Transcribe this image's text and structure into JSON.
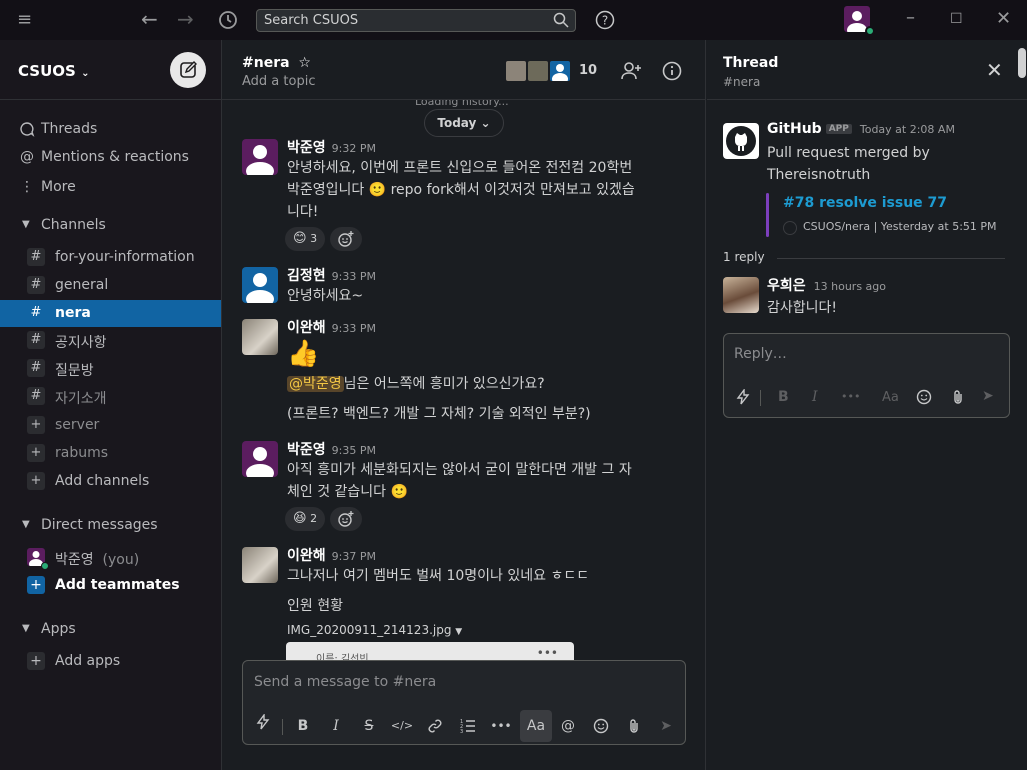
{
  "topbar": {
    "search_placeholder": "Search CSUOS"
  },
  "sidebar": {
    "workspace_name": "CSUOS",
    "nav": [
      {
        "label": "Threads",
        "icon": "threads-icon"
      },
      {
        "label": "Mentions & reactions",
        "icon": "at-icon"
      },
      {
        "label": "More",
        "icon": "more-vertical-icon"
      }
    ],
    "channels_header": "Channels",
    "channels": [
      {
        "name": "for-your-information",
        "active": false
      },
      {
        "name": "general",
        "active": false
      },
      {
        "name": "nera",
        "active": true
      },
      {
        "name": "공지사항",
        "active": false
      },
      {
        "name": "질문방",
        "active": false
      },
      {
        "name": "자기소개",
        "active": false
      },
      {
        "name": "server",
        "active": false,
        "dim": true
      },
      {
        "name": "rabums",
        "active": false,
        "dim": true
      }
    ],
    "add_channels": "Add channels",
    "dm_header": "Direct messages",
    "dm_self_name": "박준영",
    "dm_self_suffix": "(you)",
    "add_teammates": "Add teammates",
    "apps_header": "Apps",
    "add_apps": "Add apps"
  },
  "channel": {
    "name": "#nera",
    "topic": "Add a topic",
    "member_count": "10",
    "loading_text": "Loading history...",
    "day_label": "Today",
    "composer_placeholder": "Send a message to #nera"
  },
  "messages": [
    {
      "author": "박준영",
      "time": "9:32 PM",
      "lines": [
        "안녕하세요, 이번에 프론트 신입으로 들어온 전전컴 20학번",
        "박준영입니다 🙂 repo fork해서 이것저것 만져보고 있겠습",
        "니다!"
      ],
      "reaction_emoji": "😊",
      "reaction_count": "3"
    },
    {
      "author": "김정현",
      "time": "9:33 PM",
      "lines": [
        "안녕하세요~"
      ]
    },
    {
      "author": "이완해",
      "time": "9:33 PM",
      "emoji_line": "👍",
      "mention": "@박준영",
      "mention_rest": "님은 어느쪽에 흥미가 있으신가요?",
      "extra_line": "(프론트? 백엔드? 개발 그 자체? 기술 외적인 부분?)"
    },
    {
      "author": "박준영",
      "time": "9:35 PM",
      "lines": [
        "아직 흥미가 세분화되지는 않아서 굳이 말한다면 개발 그 자",
        "체인 것 같습니다 🙂"
      ],
      "reaction_emoji": "😆",
      "reaction_count": "2"
    },
    {
      "author": "이완해",
      "time": "9:37 PM",
      "lines": [
        "그나저나 여기 멤버도 벌써 10명이나 있네요 ㅎㄷㄷ",
        "인원 현황"
      ],
      "file_name": "IMG_20200911_214123.jpg",
      "file_preview_text": "이름: 김선빈"
    }
  ],
  "thread": {
    "title": "Thread",
    "channel": "#nera",
    "parent_author": "GitHub",
    "parent_badge": "APP",
    "parent_time": "Today at 2:08 AM",
    "parent_text_1": "Pull request merged by",
    "parent_text_2": "Thereisnotruth",
    "pr_title": "#78 resolve issue 77",
    "pr_repo": "CSUOS/nera",
    "pr_time": "Yesterday at 5:51 PM",
    "reply_count": "1 reply",
    "reply_author": "우희은",
    "reply_time": "13 hours ago",
    "reply_text": "감사합니다!",
    "reply_placeholder": "Reply…"
  },
  "colors": {
    "accent": "#1164a3",
    "presence": "#2bac76",
    "link": "#1d9bd1",
    "mention_bg": "#58452a",
    "mention_fg": "#f2c744"
  }
}
